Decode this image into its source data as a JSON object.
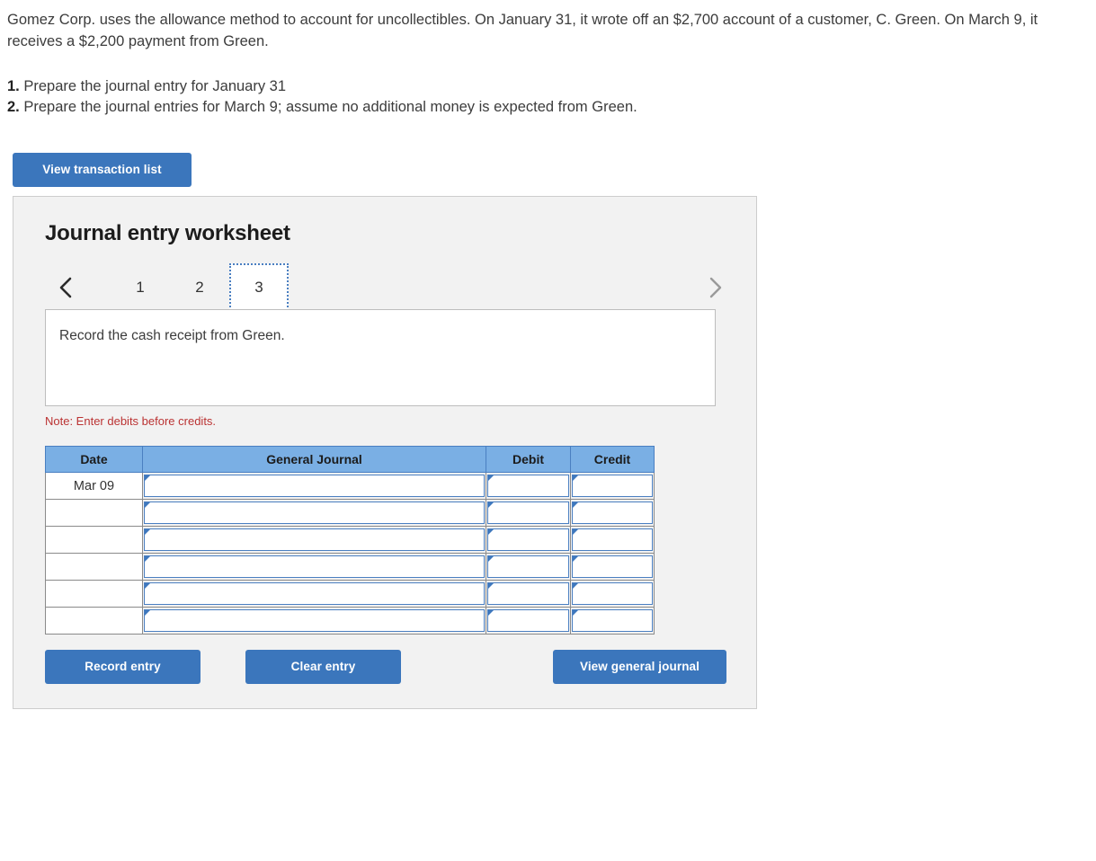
{
  "problem": {
    "statement": "Gomez Corp. uses the allowance method to account for uncollectibles. On January 31, it wrote off an $2,700 account of a customer, C. Green. On March 9, it receives a $2,200 payment from Green.",
    "steps": [
      {
        "num": "1.",
        "text": "Prepare the journal entry for January 31"
      },
      {
        "num": "2.",
        "text": "Prepare the journal entries for March 9; assume no additional money is expected from Green."
      }
    ]
  },
  "toolbar": {
    "view_transaction_list_label": "View transaction list"
  },
  "worksheet": {
    "title": "Journal entry worksheet",
    "pager": {
      "prev_icon": "chevron-left-icon",
      "next_icon": "chevron-right-icon",
      "tabs": [
        {
          "label": "1",
          "active": false
        },
        {
          "label": "2",
          "active": false
        },
        {
          "label": "3",
          "active": true
        }
      ]
    },
    "description": "Record the cash receipt from Green.",
    "note": "Note: Enter debits before credits.",
    "table": {
      "headers": [
        "Date",
        "General Journal",
        "Debit",
        "Credit"
      ],
      "rows": [
        {
          "date": "Mar 09",
          "general_journal": "",
          "debit": "",
          "credit": ""
        },
        {
          "date": "",
          "general_journal": "",
          "debit": "",
          "credit": ""
        },
        {
          "date": "",
          "general_journal": "",
          "debit": "",
          "credit": ""
        },
        {
          "date": "",
          "general_journal": "",
          "debit": "",
          "credit": ""
        },
        {
          "date": "",
          "general_journal": "",
          "debit": "",
          "credit": ""
        },
        {
          "date": "",
          "general_journal": "",
          "debit": "",
          "credit": ""
        }
      ]
    },
    "actions": {
      "record_entry_label": "Record entry",
      "clear_entry_label": "Clear entry",
      "view_general_journal_label": "View general journal"
    }
  },
  "colors": {
    "button_blue": "#3b76bc",
    "header_blue": "#7aafe4",
    "cell_border_blue": "#4a7fc1",
    "note_red": "#bb3333",
    "panel_gray": "#f2f2f2"
  }
}
